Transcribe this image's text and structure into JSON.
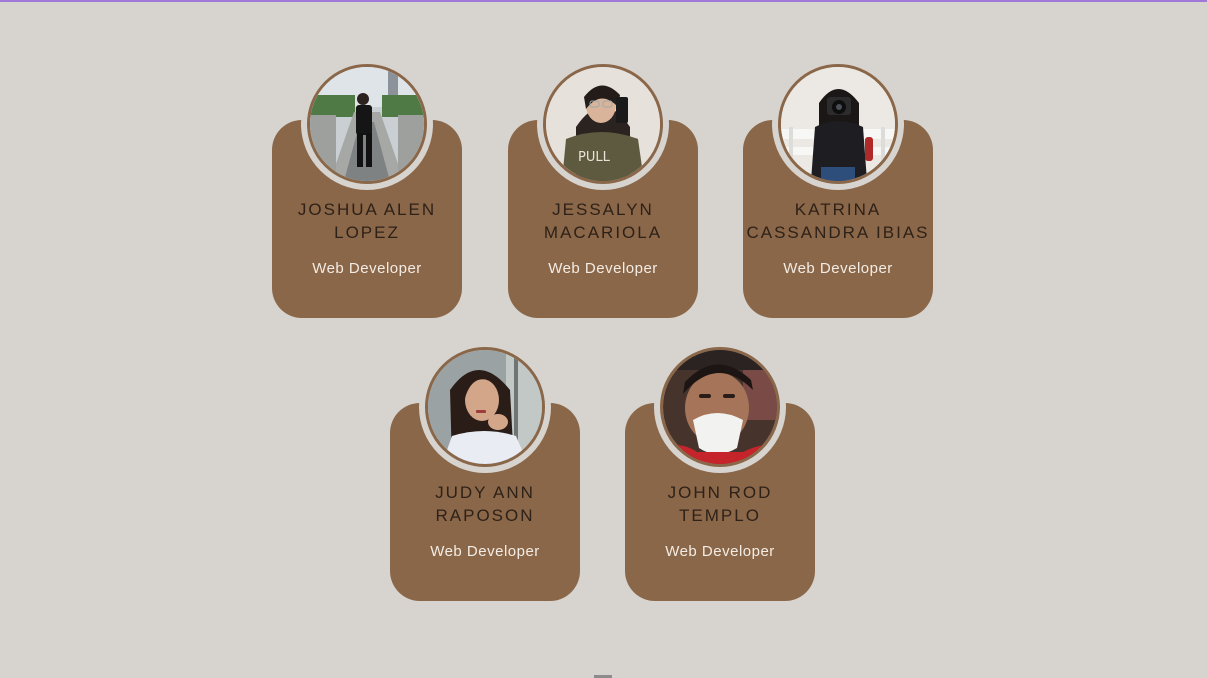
{
  "team": [
    {
      "name_line1": "JOSHUA ALEN",
      "name_line2": "LOPEZ",
      "role": "Web Developer",
      "photo_icon": "person-photo-1"
    },
    {
      "name_line1": "JESSALYN",
      "name_line2": "MACARIOLA",
      "role": "Web Developer",
      "photo_icon": "person-photo-2"
    },
    {
      "name_line1": "KATRINA",
      "name_line2": "CASSANDRA IBIAS",
      "role": "Web Developer",
      "photo_icon": "person-photo-3"
    },
    {
      "name_line1": "JUDY ANN",
      "name_line2": "RAPOSON",
      "role": "Web Developer",
      "photo_icon": "person-photo-4"
    },
    {
      "name_line1": "JOHN ROD",
      "name_line2": "TEMPLO",
      "role": "Web Developer",
      "photo_icon": "person-photo-5"
    }
  ],
  "colors": {
    "background": "#d7d3cf",
    "card": "#8a6749",
    "name_text": "#2e2118",
    "role_text": "#f3ece4",
    "accent_line": "#a078d8"
  }
}
